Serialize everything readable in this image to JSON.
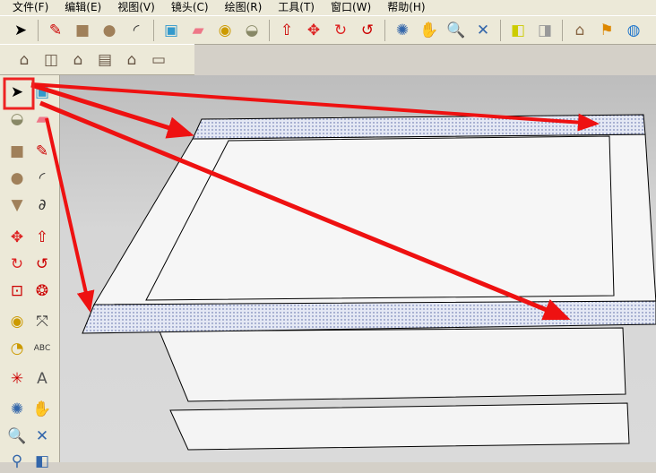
{
  "menu": [
    "文件(F)",
    "编辑(E)",
    "视图(V)",
    "镜头(C)",
    "绘图(R)",
    "工具(T)",
    "窗口(W)",
    "帮助(H)"
  ],
  "toolbar_main": [
    {
      "name": "select-icon",
      "g": "➤",
      "c": "#000"
    },
    {
      "sep": 1
    },
    {
      "name": "pencil-icon",
      "g": "✎",
      "c": "#c00"
    },
    {
      "name": "rectangle-icon",
      "g": "■",
      "c": "#a0805a"
    },
    {
      "name": "circle-icon",
      "g": "●",
      "c": "#a0805a"
    },
    {
      "name": "arc-icon",
      "g": "◜",
      "c": "#333"
    },
    {
      "sep": 1
    },
    {
      "name": "make-component-icon",
      "g": "▣",
      "c": "#39c"
    },
    {
      "name": "eraser-icon",
      "g": "▰",
      "c": "#e78"
    },
    {
      "name": "tape-measure-icon",
      "g": "◉",
      "c": "#cc9a00"
    },
    {
      "name": "paint-bucket-icon",
      "g": "◒",
      "c": "#886"
    },
    {
      "sep": 1
    },
    {
      "name": "push-pull-icon",
      "g": "⇧",
      "c": "#c00"
    },
    {
      "name": "move-icon",
      "g": "✥",
      "c": "#d22"
    },
    {
      "name": "rotate-icon",
      "g": "↻",
      "c": "#d22"
    },
    {
      "name": "follow-me-icon",
      "g": "↺",
      "c": "#c00"
    },
    {
      "sep": 1
    },
    {
      "name": "orbit-icon",
      "g": "✺",
      "c": "#36a"
    },
    {
      "name": "pan-icon",
      "g": "✋",
      "c": "#555"
    },
    {
      "name": "zoom-icon",
      "g": "🔍",
      "c": "#335"
    },
    {
      "name": "zoom-extents-icon",
      "g": "✕",
      "c": "#36a"
    },
    {
      "sep": 1
    },
    {
      "name": "previous-view-icon",
      "g": "◧",
      "c": "#cc0"
    },
    {
      "name": "next-view-icon",
      "g": "◨",
      "c": "#999"
    },
    {
      "sep": 1
    },
    {
      "name": "add-location-icon",
      "g": "⌂",
      "c": "#864"
    },
    {
      "name": "add-geo-icon",
      "g": "⚑",
      "c": "#d80"
    },
    {
      "name": "google-earth-icon",
      "g": "◍",
      "c": "#27c"
    }
  ],
  "toolbar_views": [
    {
      "name": "iso-view-icon",
      "g": "⌂"
    },
    {
      "name": "right-view-icon",
      "g": "◫"
    },
    {
      "name": "front-view-icon",
      "g": "⌂"
    },
    {
      "name": "top-view-icon",
      "g": "▤"
    },
    {
      "name": "back-view-icon",
      "g": "⌂"
    },
    {
      "name": "left-view-icon",
      "g": "▭"
    }
  ],
  "left_tools": [
    [
      "select-icon",
      "➤",
      "#000"
    ],
    [
      "make-component-icon",
      "▣",
      "#39c"
    ],
    [
      "paint-bucket-icon",
      "◒",
      "#886"
    ],
    [
      "eraser-icon",
      "▰",
      "#e78"
    ],
    [
      "rectangle-icon",
      "■",
      "#a0805a"
    ],
    [
      "pencil-icon",
      "✎",
      "#c00"
    ],
    [
      "circle-icon",
      "●",
      "#a0805a"
    ],
    [
      "arc-icon",
      "◜",
      "#333"
    ],
    [
      "polygon-icon",
      "▼",
      "#a0805a"
    ],
    [
      "freehand-icon",
      "∂",
      "#333"
    ],
    [
      "move-icon",
      "✥",
      "#d22"
    ],
    [
      "push-pull-icon",
      "⇧",
      "#c00"
    ],
    [
      "rotate-icon",
      "↻",
      "#d22"
    ],
    [
      "follow-me-icon",
      "↺",
      "#c00"
    ],
    [
      "scale-icon",
      "⊡",
      "#c00"
    ],
    [
      "offset-icon",
      "❂",
      "#c00"
    ],
    [
      "tape-measure-icon",
      "◉",
      "#cc9a00"
    ],
    [
      "dimension-icon",
      "⤧",
      "#333"
    ],
    [
      "protractor-icon",
      "◔",
      "#cc9a00"
    ],
    [
      "text-icon",
      "ABC",
      "#333"
    ],
    [
      "axes-icon",
      "✳",
      "#c00"
    ],
    [
      "3d-text-icon",
      "A",
      "#555"
    ],
    [
      "orbit-icon",
      "✺",
      "#36a"
    ],
    [
      "pan-icon",
      "✋",
      "#555"
    ],
    [
      "zoom-icon",
      "🔍",
      "#335"
    ],
    [
      "zoom-extents-icon",
      "✕",
      "#36a"
    ],
    [
      "zoom-window-icon",
      "⚲",
      "#36a"
    ],
    [
      "previous-view-icon",
      "◧",
      "#36a"
    ]
  ],
  "colors": {
    "arrow": "#ee1111",
    "highlight": "#ee2222"
  }
}
